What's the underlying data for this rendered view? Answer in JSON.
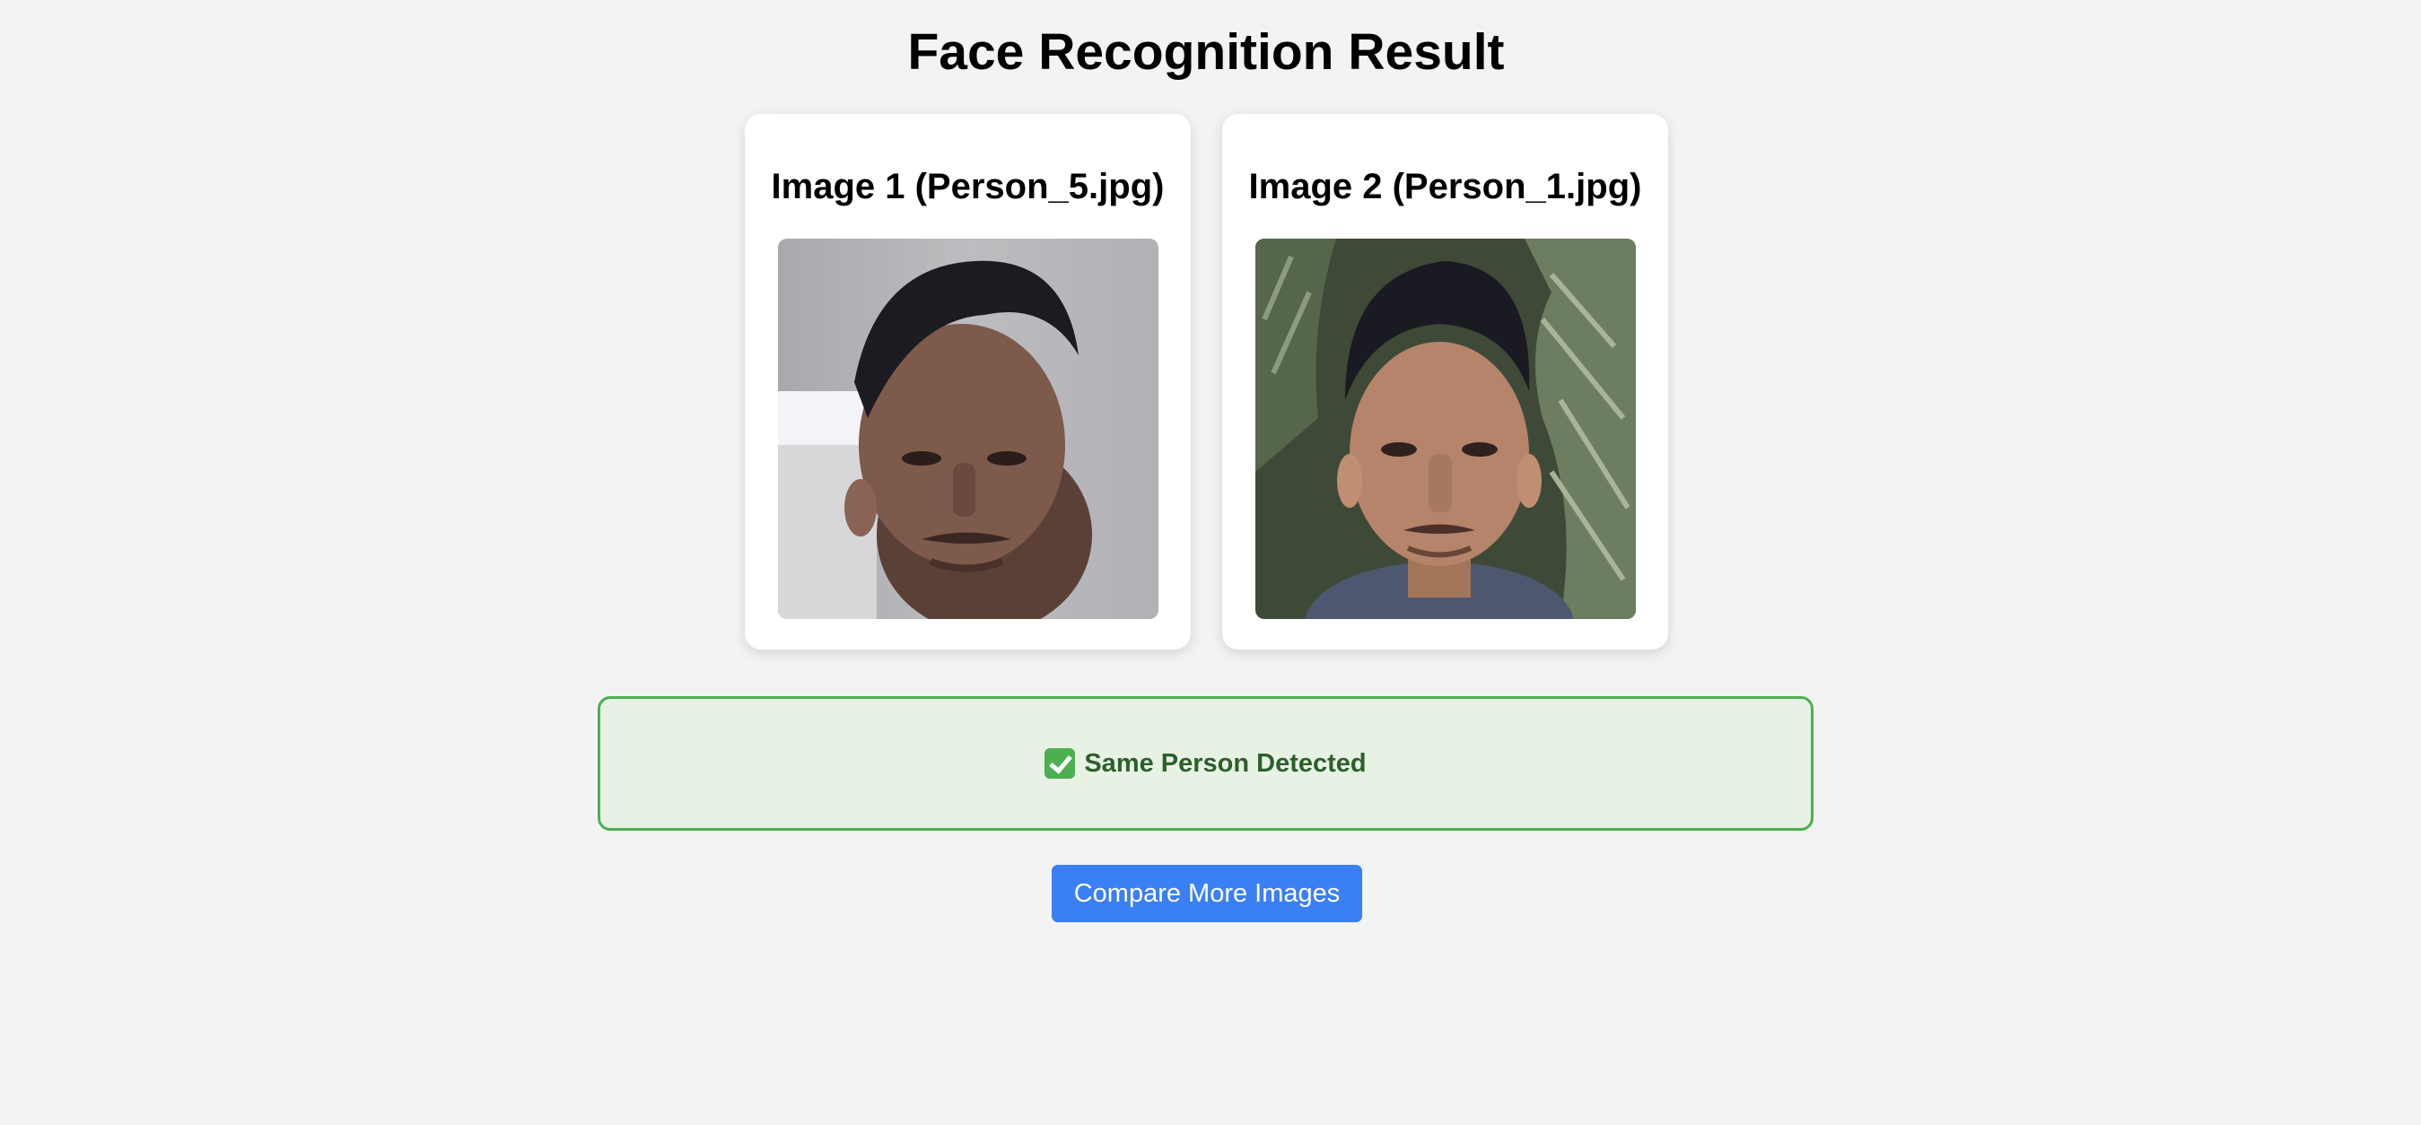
{
  "page": {
    "title": "Face Recognition Result"
  },
  "images": [
    {
      "title": "Image 1 (Person_5.jpg)",
      "photo_icon": "portrait-photo"
    },
    {
      "title": "Image 2 (Person_1.jpg)",
      "photo_icon": "portrait-photo"
    }
  ],
  "result": {
    "icon": "check-mark-icon",
    "text": "Same Person Detected",
    "status": "match",
    "color": "#4caf50"
  },
  "actions": {
    "compare_label": "Compare More Images",
    "button_color": "#3b7ff5"
  }
}
